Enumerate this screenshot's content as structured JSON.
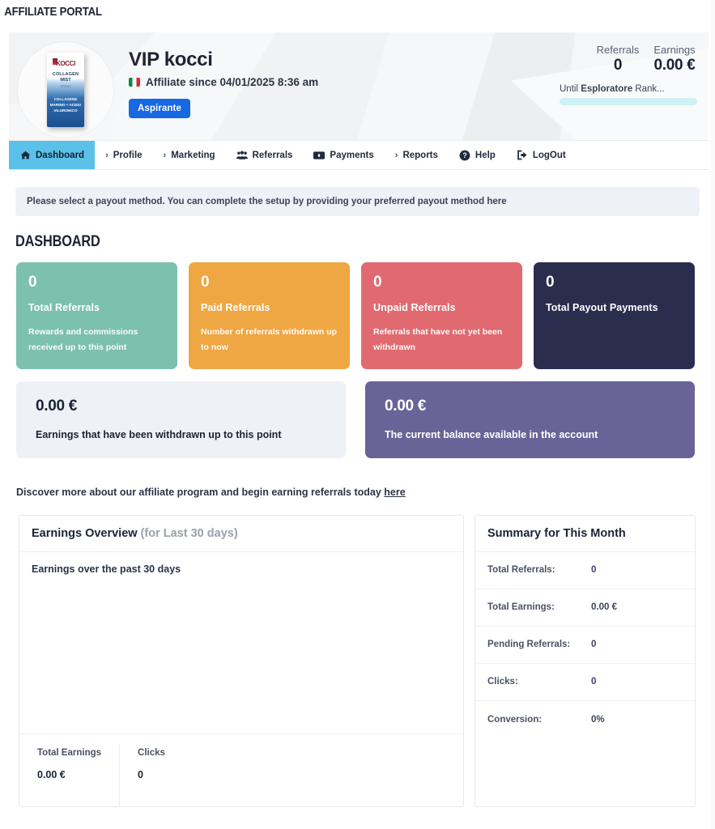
{
  "portal": {
    "title": "AFFILIATE PORTAL"
  },
  "profile": {
    "name": "VIP kocci",
    "since_text": "Affiliate since 04/01/2025 8:36 am",
    "flag": "italy-flag-icon",
    "rank_badge": "Aspirante",
    "avatar": {
      "alt": "kocci-product-avatar",
      "brand": "KOCCI",
      "line1": "COLLAGEN",
      "line2": "MIST",
      "line3": "SPRAY",
      "line4": "COLLAGENE MARINO + ACIDO IALURONICO"
    }
  },
  "header_stats": {
    "referrals_label": "Referrals",
    "referrals_value": "0",
    "earnings_label": "Earnings",
    "earnings_value": "0.00 €",
    "rank_progress_prefix": "Until ",
    "rank_progress_name": "Esploratore",
    "rank_progress_suffix": " Rank...",
    "progress_percent": 100,
    "progress_color": "#cdf1f4"
  },
  "nav": {
    "items": [
      {
        "label": "Dashboard",
        "icon": "home-icon",
        "active": true
      },
      {
        "label": "Profile",
        "icon": "chevron-right-icon",
        "active": false
      },
      {
        "label": "Marketing",
        "icon": "chevron-right-icon",
        "active": false
      },
      {
        "label": "Referrals",
        "icon": "users-icon",
        "active": false
      },
      {
        "label": "Payments",
        "icon": "money-bill-icon",
        "active": false
      },
      {
        "label": "Reports",
        "icon": "chevron-right-icon",
        "active": false
      },
      {
        "label": "Help",
        "icon": "question-circle-icon",
        "active": false
      },
      {
        "label": "LogOut",
        "icon": "sign-out-icon",
        "active": false
      }
    ],
    "active_color": "#5bc1e8"
  },
  "alert": {
    "text": "Please select a payout method. You can complete the setup by providing your preferred payout method ",
    "link": "here"
  },
  "dashboard_heading": "DASHBOARD",
  "kpi_cards": [
    {
      "value": "0",
      "title": "Total Referrals",
      "subtitle": "Rewards and commissions received up to this point",
      "color": "#7cc0ae"
    },
    {
      "value": "0",
      "title": "Paid Referrals",
      "subtitle": "Number of referrals withdrawn up to now",
      "color": "#efa743"
    },
    {
      "value": "0",
      "title": "Unpaid Referrals",
      "subtitle": "Referrals that have not yet been withdrawn",
      "color": "#e06a70"
    },
    {
      "value": "0",
      "title": "Total Payout Payments",
      "subtitle": "",
      "color": "#2b2d4e"
    }
  ],
  "earnings_cards": [
    {
      "value": "0.00 €",
      "description": "Earnings that have been withdrawn up to this point",
      "color": "#eef1f6",
      "style": "light"
    },
    {
      "value": "0.00 €",
      "description": "The current balance available in the account",
      "color": "#6a6397",
      "style": "purple"
    }
  ],
  "discover": {
    "text": "Discover more about our affiliate program and begin earning referrals today ",
    "link": "here"
  },
  "earnings_overview": {
    "title": "Earnings Overview",
    "subtitle": "(for Last 30 days)",
    "note": "Earnings over the past 30 days",
    "footer": [
      {
        "label": "Total Earnings",
        "value": "0.00 €"
      },
      {
        "label": "Clicks",
        "value": "0"
      }
    ]
  },
  "summary": {
    "title": "Summary for This Month",
    "rows": [
      {
        "label": "Total Referrals:",
        "value": "0"
      },
      {
        "label": "Total Earnings:",
        "value": "0.00 €"
      },
      {
        "label": "Pending Referrals:",
        "value": "0"
      },
      {
        "label": "Clicks:",
        "value": "0"
      },
      {
        "label": "Conversion:",
        "value": "0%"
      }
    ]
  },
  "chart_data": {
    "type": "line",
    "title": "Earnings Overview (for Last 30 days)",
    "subtitle": "Earnings over the past 30 days",
    "xlabel": "",
    "ylabel": "",
    "x": [],
    "series": [
      {
        "name": "Earnings",
        "values": []
      }
    ],
    "grid": false,
    "legend": "none",
    "empty": true
  }
}
